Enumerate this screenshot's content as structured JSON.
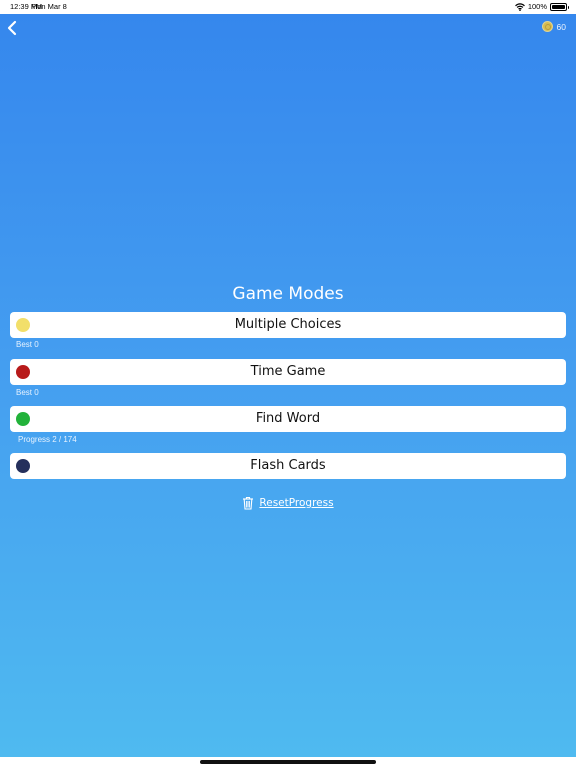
{
  "status_bar": {
    "time": "12:39 PM",
    "date": "Mon Mar 8",
    "battery": "100%",
    "battery_level": 1.0
  },
  "header": {
    "coins": "60"
  },
  "title": "Game Modes",
  "modes": [
    {
      "label": "Multiple Choices",
      "dot_color": "#f2df6a",
      "sub": "Best 0"
    },
    {
      "label": "Time Game",
      "dot_color": "#b81a1a",
      "sub": "Best 0"
    },
    {
      "label": "Find Word",
      "dot_color": "#22b23a",
      "sub": "Progress 2 / 174"
    },
    {
      "label": "Flash Cards",
      "dot_color": "#25305c",
      "sub": ""
    }
  ],
  "reset": {
    "label": "ResetProgress",
    "icon": "trash-icon"
  },
  "colors": {
    "gradient_top": "#3587ed",
    "gradient_bottom": "#4fbaf0",
    "card": "#ffffff",
    "coin": "#e9c341"
  }
}
